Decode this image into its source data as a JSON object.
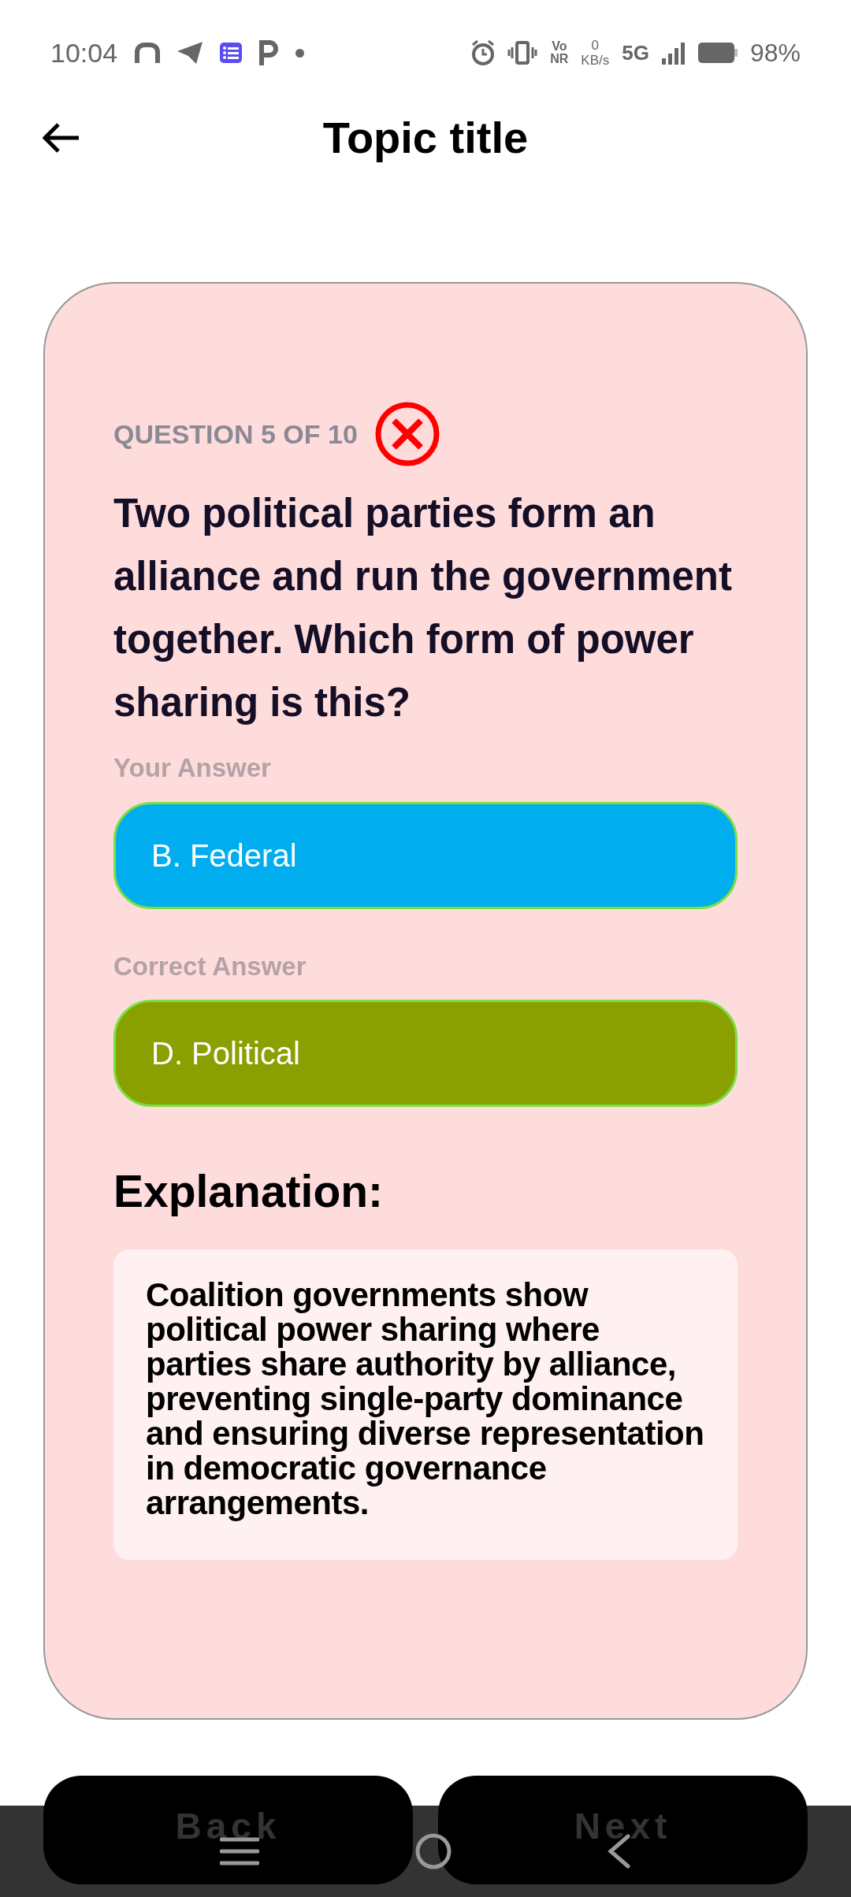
{
  "status_bar": {
    "time": "10:04",
    "volte": [
      "Vo",
      "NR"
    ],
    "speed": [
      "0",
      "KB/s"
    ],
    "network": "5G",
    "battery": "98%"
  },
  "header": {
    "title": "Topic title"
  },
  "question": {
    "counter": "QUESTION 5 OF 10",
    "correct": false,
    "text": "Two political parties form an alliance and run the government together. Which form of power sharing is this?"
  },
  "answers": [
    {
      "label": "Your Answer",
      "value": "B. Federal",
      "color": "#00aeef"
    },
    {
      "label": "Correct Answer",
      "value": "D. Political",
      "color": "#8a9f00"
    }
  ],
  "explanation": {
    "title": "Explanation:",
    "text": "Coalition governments show political power sharing where parties share authority by alliance, preventing single-party dominance and ensuring diverse representation in democratic governance arrangements."
  },
  "buttons": [
    {
      "label": "Back"
    },
    {
      "label": "Next"
    }
  ]
}
